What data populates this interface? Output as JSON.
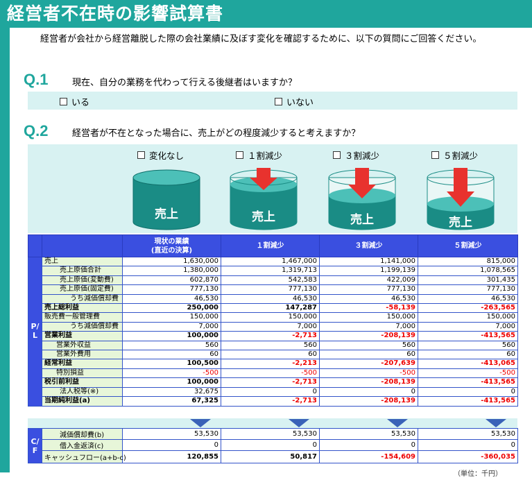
{
  "title": "経営者不在時の影響試算書",
  "intro": "経営者が会社から経営離脱した際の会社業績に及ぼす変化を確認するために、以下の質問にご回答ください。",
  "q1": {
    "label": "Q.1",
    "text": "現在、自分の業務を代わって行える後継者はいますか？",
    "options": [
      "いる",
      "いない"
    ]
  },
  "q2": {
    "label": "Q.2",
    "text": "経営者が不在となった場合に、売上がどの程度減少すると考えますか？",
    "options": [
      "変化なし",
      "１割減少",
      "３割減少",
      "５割減少"
    ],
    "cylinder_label": "売上"
  },
  "table": {
    "headers": [
      "現状の業績\n(直近の決算)",
      "１割減少",
      "３割減少",
      "５割減少"
    ],
    "side_pl": "P/L",
    "side_cf": "C/F",
    "rows": [
      {
        "label": "売上",
        "values": [
          "1,630,000",
          "1,467,000",
          "1,141,000",
          "815,000"
        ]
      },
      {
        "label": "売上原価合計",
        "values": [
          "1,380,000",
          "1,319,713",
          "1,199,139",
          "1,078,565"
        ]
      },
      {
        "label": "売上原価(変動費)",
        "values": [
          "602,870",
          "542,583",
          "422,009",
          "301,435"
        ]
      },
      {
        "label": "売上原価(固定費)",
        "values": [
          "777,130",
          "777,130",
          "777,130",
          "777,130"
        ]
      },
      {
        "label": "うち減価償却費",
        "values": [
          "46,530",
          "46,530",
          "46,530",
          "46,530"
        ]
      },
      {
        "label": "売上総利益",
        "values": [
          "250,000",
          "147,287",
          "-58,139",
          "-263,565"
        ]
      },
      {
        "label": "販売費一般管理費",
        "values": [
          "150,000",
          "150,000",
          "150,000",
          "150,000"
        ]
      },
      {
        "label": "うち減価償却費",
        "values": [
          "7,000",
          "7,000",
          "7,000",
          "7,000"
        ]
      },
      {
        "label": "営業利益",
        "values": [
          "100,000",
          "-2,713",
          "-208,139",
          "-413,565"
        ]
      },
      {
        "label": "営業外収益",
        "values": [
          "560",
          "560",
          "560",
          "560"
        ]
      },
      {
        "label": "営業外費用",
        "values": [
          "60",
          "60",
          "60",
          "60"
        ]
      },
      {
        "label": "経常利益",
        "values": [
          "100,500",
          "-2,213",
          "-207,639",
          "-413,065"
        ]
      },
      {
        "label": "特別損益",
        "values": [
          "-500",
          "-500",
          "-500",
          "-500"
        ]
      },
      {
        "label": "税引前利益",
        "values": [
          "100,000",
          "-2,713",
          "-208,139",
          "-413,565"
        ]
      },
      {
        "label": "法人税等(※)",
        "values": [
          "32,675",
          "0",
          "0",
          "0"
        ]
      },
      {
        "label": "当期純利益(a)",
        "values": [
          "67,325",
          "-2,713",
          "-208,139",
          "-413,565"
        ]
      }
    ],
    "cf_rows": [
      {
        "label": "減価償却費(b)",
        "values": [
          "53,530",
          "53,530",
          "53,530",
          "53,530"
        ]
      },
      {
        "label": "借入金返済(c)",
        "values": [
          "0",
          "0",
          "0",
          "0"
        ]
      },
      {
        "label": "キャッシュフロー(a+b-c)",
        "values": [
          "120,855",
          "50,817",
          "-154,609",
          "-360,035"
        ]
      }
    ],
    "unit": "（単位：千円）"
  },
  "colors": {
    "teal": "#1fa69d",
    "header_blue": "#3a4fe0",
    "light_teal": "#d8f2f2",
    "label_green": "#e7f6d9",
    "arrow_red": "#e8322e",
    "negative": "#e00000"
  }
}
